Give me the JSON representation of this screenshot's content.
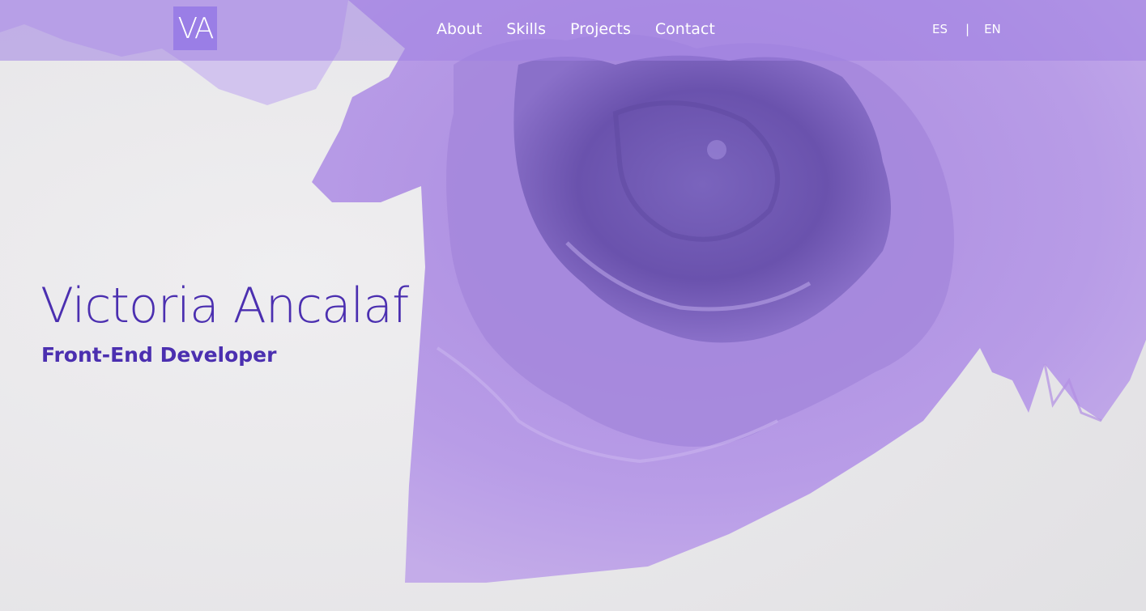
{
  "header": {
    "logo_text": "VA",
    "nav": [
      {
        "label": "About"
      },
      {
        "label": "Skills"
      },
      {
        "label": "Projects"
      },
      {
        "label": "Contact"
      }
    ],
    "languages": {
      "es": "ES",
      "separator": "|",
      "en": "EN"
    }
  },
  "hero": {
    "name": "Victoria Ancalaf",
    "role": "Front-End Developer",
    "background_image": "purple-ink-bloom"
  },
  "colors": {
    "accent": "#4b2fb0",
    "nav_bg": "#a082e1",
    "logo_bg": "#9a7ee6",
    "ink_light": "#b79be6",
    "ink_dark": "#6d55b0",
    "paper": "#e7e6e8"
  }
}
